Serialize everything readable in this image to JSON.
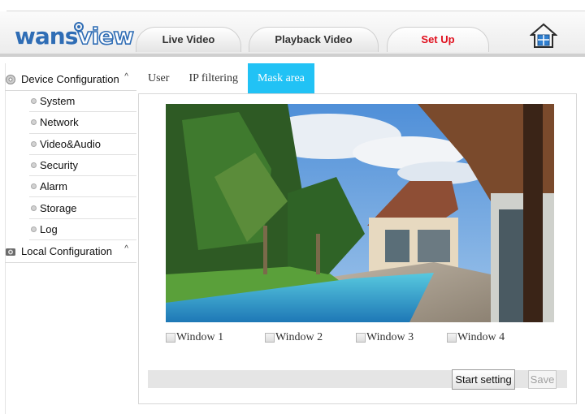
{
  "app": {
    "logo_text_a": "wans",
    "logo_text_b": "view"
  },
  "nav": {
    "tabs": [
      {
        "label": "Live Video",
        "active": false
      },
      {
        "label": "Playback Video",
        "active": false
      },
      {
        "label": "Set Up",
        "active": true
      }
    ],
    "home_icon": "home-icon"
  },
  "sidebar": {
    "device_config": {
      "label": "Device Configuration",
      "icon": "gear-icon",
      "items": [
        {
          "label": "System"
        },
        {
          "label": "Network"
        },
        {
          "label": "Video&Audio"
        },
        {
          "label": "Security"
        },
        {
          "label": "Alarm"
        },
        {
          "label": "Storage"
        },
        {
          "label": "Log"
        }
      ]
    },
    "local_config": {
      "label": "Local Configuration",
      "icon": "camera-icon"
    }
  },
  "subtabs": [
    {
      "label": "User",
      "active": false
    },
    {
      "label": "IP filtering",
      "active": false
    },
    {
      "label": "Mask area",
      "active": true
    }
  ],
  "mask": {
    "windows": [
      {
        "label": "Window 1",
        "checked": false
      },
      {
        "label": "Window 2",
        "checked": false
      },
      {
        "label": "Window 3",
        "checked": false
      },
      {
        "label": "Window 4",
        "checked": false
      }
    ],
    "start_label": "Start setting",
    "save_label": "Save"
  },
  "colors": {
    "accent_active_subtab": "#21c2f5",
    "active_nav": "#e0101e",
    "brand": "#2f6db5"
  }
}
